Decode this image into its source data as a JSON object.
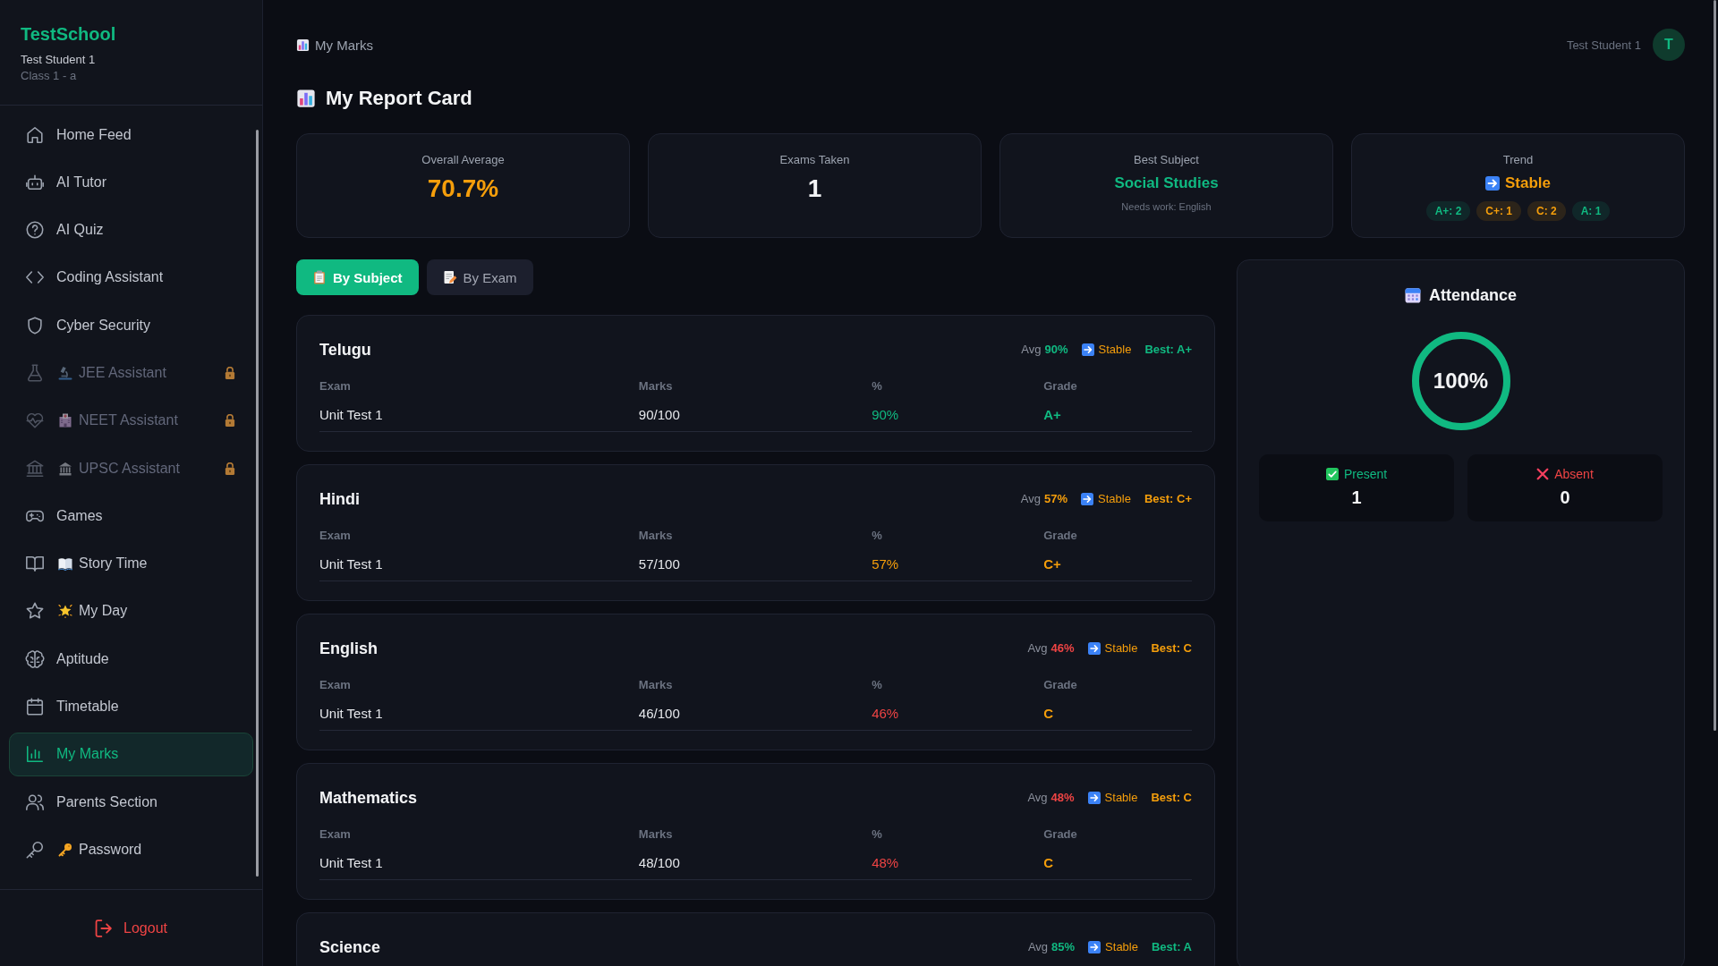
{
  "sidebar": {
    "school": "TestSchool",
    "student": "Test Student 1",
    "class": "Class 1 - a",
    "items": [
      {
        "label": "Home Feed",
        "selected": false,
        "locked": false
      },
      {
        "label": "AI Tutor",
        "selected": false,
        "locked": false
      },
      {
        "label": "AI Quiz",
        "selected": false,
        "locked": false
      },
      {
        "label": "Coding Assistant",
        "selected": false,
        "locked": false
      },
      {
        "label": "Cyber Security",
        "selected": false,
        "locked": false
      },
      {
        "label": "JEE Assistant",
        "selected": false,
        "locked": true
      },
      {
        "label": "NEET Assistant",
        "selected": false,
        "locked": true
      },
      {
        "label": "UPSC Assistant",
        "selected": false,
        "locked": true
      },
      {
        "label": "Games",
        "selected": false,
        "locked": false
      },
      {
        "label": "Story Time",
        "selected": false,
        "locked": false
      },
      {
        "label": "My Day",
        "selected": false,
        "locked": false
      },
      {
        "label": "Aptitude",
        "selected": false,
        "locked": false
      },
      {
        "label": "Timetable",
        "selected": false,
        "locked": false
      },
      {
        "label": "My Marks",
        "selected": true,
        "locked": false
      },
      {
        "label": "Parents Section",
        "selected": false,
        "locked": false
      },
      {
        "label": "Password",
        "selected": false,
        "locked": false
      }
    ],
    "logout": "Logout"
  },
  "header": {
    "breadcrumb": "My Marks",
    "user": "Test Student 1",
    "avatar": "T"
  },
  "page_title": "My Report Card",
  "stats": [
    {
      "kind": "value",
      "label": "Overall Average",
      "value": "70.7%",
      "color": "#f59e0b"
    },
    {
      "kind": "value",
      "label": "Exams Taken",
      "value": "1",
      "color": "#f3f4f6"
    },
    {
      "kind": "subject",
      "label": "Best Subject",
      "value": "Social Studies",
      "note": "Needs work: English",
      "color": "#10b981"
    },
    {
      "kind": "trend",
      "label": "Trend",
      "value": "Stable",
      "color": "#f59e0b",
      "grades": [
        {
          "text": "A+: 2",
          "color": "#10b981"
        },
        {
          "text": "C+: 1",
          "color": "#f59e0b"
        },
        {
          "text": "C: 2",
          "color": "#f59e0b"
        },
        {
          "text": "A: 1",
          "color": "#10b981"
        }
      ]
    }
  ],
  "tabs": [
    {
      "label": "By Subject",
      "selected": true
    },
    {
      "label": "By Exam",
      "selected": false
    }
  ],
  "subjects": [
    {
      "name": "Telugu",
      "avg": {
        "label": "Avg",
        "value": "90%",
        "color": "#10b981"
      },
      "trend": "Stable",
      "best": {
        "text": "Best: A+",
        "color": "#10b981"
      },
      "columns": [
        "Exam",
        "Marks",
        "%",
        "Grade"
      ],
      "rows": [
        {
          "exam": "Unit Test 1",
          "marks": "90/100",
          "percent": {
            "text": "90%",
            "color": "#10b981"
          },
          "grade": {
            "text": "A+",
            "color": "#10b981"
          }
        }
      ]
    },
    {
      "name": "Hindi",
      "avg": {
        "label": "Avg",
        "value": "57%",
        "color": "#f59e0b"
      },
      "trend": "Stable",
      "best": {
        "text": "Best: C+",
        "color": "#f59e0b"
      },
      "columns": [
        "Exam",
        "Marks",
        "%",
        "Grade"
      ],
      "rows": [
        {
          "exam": "Unit Test 1",
          "marks": "57/100",
          "percent": {
            "text": "57%",
            "color": "#f59e0b"
          },
          "grade": {
            "text": "C+",
            "color": "#f59e0b"
          }
        }
      ]
    },
    {
      "name": "English",
      "avg": {
        "label": "Avg",
        "value": "46%",
        "color": "#ef4444"
      },
      "trend": "Stable",
      "best": {
        "text": "Best: C",
        "color": "#f59e0b"
      },
      "columns": [
        "Exam",
        "Marks",
        "%",
        "Grade"
      ],
      "rows": [
        {
          "exam": "Unit Test 1",
          "marks": "46/100",
          "percent": {
            "text": "46%",
            "color": "#ef4444"
          },
          "grade": {
            "text": "C",
            "color": "#f59e0b"
          }
        }
      ]
    },
    {
      "name": "Mathematics",
      "avg": {
        "label": "Avg",
        "value": "48%",
        "color": "#ef4444"
      },
      "trend": "Stable",
      "best": {
        "text": "Best: C",
        "color": "#f59e0b"
      },
      "columns": [
        "Exam",
        "Marks",
        "%",
        "Grade"
      ],
      "rows": [
        {
          "exam": "Unit Test 1",
          "marks": "48/100",
          "percent": {
            "text": "48%",
            "color": "#ef4444"
          },
          "grade": {
            "text": "C",
            "color": "#f59e0b"
          }
        }
      ]
    },
    {
      "name": "Science",
      "avg": {
        "label": "Avg",
        "value": "85%",
        "color": "#10b981"
      },
      "trend": "Stable",
      "best": {
        "text": "Best: A",
        "color": "#10b981"
      }
    }
  ],
  "attendance": {
    "title": "Attendance",
    "level": 1,
    "reading": "100%",
    "counts": [
      {
        "label": "Present",
        "value": "1",
        "color": "#10b981"
      },
      {
        "label": "Absent",
        "value": "0",
        "color": "#ef4444"
      }
    ]
  }
}
